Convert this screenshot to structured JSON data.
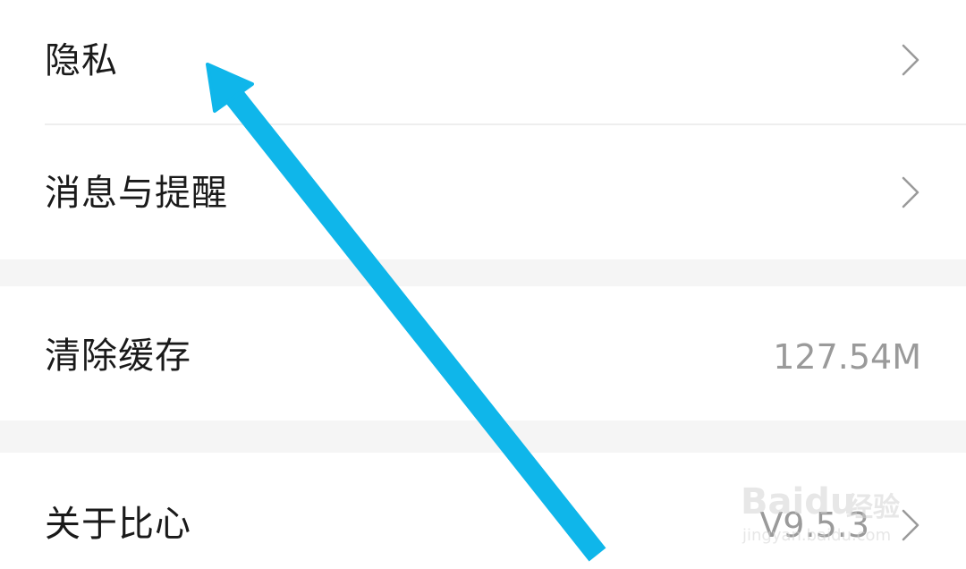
{
  "settings": {
    "items": [
      {
        "label": "隐私"
      },
      {
        "label": "消息与提醒"
      },
      {
        "label": "清除缓存",
        "value": "127.54M"
      },
      {
        "label": "关于比心",
        "value": "V9.5.3"
      }
    ]
  },
  "watermark": {
    "brand": "Baidu",
    "cn": "经验",
    "url": "jingyan.baidu.com"
  },
  "colors": {
    "arrow": "#0fb6ea",
    "label": "#1a1a1a",
    "value": "#9a9a9a",
    "section_gap": "#f5f5f5"
  },
  "icons": {
    "chevron": "chevron-right-icon",
    "annotation": "arrow-annotation"
  }
}
